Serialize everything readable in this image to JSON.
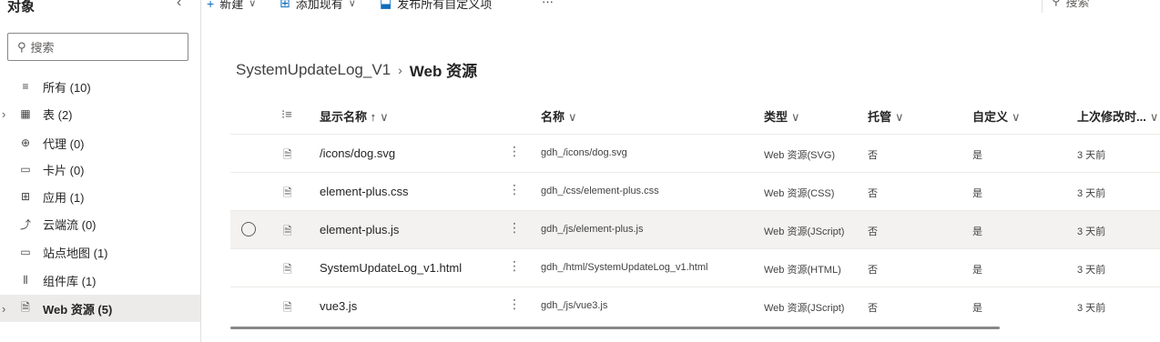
{
  "panel": {
    "title": "对象",
    "collapse_icon": "‹",
    "search_placeholder": "搜索",
    "items": [
      {
        "label": "所有 (10)",
        "icon": "≡",
        "chev": ""
      },
      {
        "label": "表 (2)",
        "icon": "▦",
        "chev": "›"
      },
      {
        "label": "代理 (0)",
        "icon": "⊕",
        "chev": ""
      },
      {
        "label": "卡片 (0)",
        "icon": "▭",
        "chev": ""
      },
      {
        "label": "应用 (1)",
        "icon": "⊞",
        "chev": ""
      },
      {
        "label": "云端流 (0)",
        "icon": "⤴",
        "chev": ""
      },
      {
        "label": "站点地图 (1)",
        "icon": "▭",
        "chev": ""
      },
      {
        "label": "组件库 (1)",
        "icon": "⫴",
        "chev": ""
      },
      {
        "label": "Web 资源 (5)",
        "icon": "🗎",
        "chev": "›"
      }
    ]
  },
  "toolbar": {
    "new_label": "新建",
    "add_existing_label": "添加现有",
    "publish_label": "发布所有自定义项",
    "more_label": "···",
    "search_label": "搜索"
  },
  "breadcrumb": {
    "parent": "SystemUpdateLog_V1",
    "current": "Web 资源"
  },
  "table": {
    "headers": {
      "display_name": "显示名称 ↑",
      "name": "名称",
      "type": "类型",
      "managed": "托管",
      "customizable": "自定义",
      "modified": "上次修改时..."
    },
    "rows": [
      {
        "display": "/icons/dog.svg",
        "name": "gdh_/icons/dog.svg",
        "type": "Web 资源(SVG)",
        "managed": "否",
        "custom": "是",
        "modified": "3 天前"
      },
      {
        "display": "element-plus.css",
        "name": "gdh_/css/element-plus.css",
        "type": "Web 资源(CSS)",
        "managed": "否",
        "custom": "是",
        "modified": "3 天前"
      },
      {
        "display": "element-plus.js",
        "name": "gdh_/js/element-plus.js",
        "type": "Web 资源(JScript)",
        "managed": "否",
        "custom": "是",
        "modified": "3 天前"
      },
      {
        "display": "SystemUpdateLog_v1.html",
        "name": "gdh_/html/SystemUpdateLog_v1.html",
        "type": "Web 资源(HTML)",
        "managed": "否",
        "custom": "是",
        "modified": "3 天前"
      },
      {
        "display": "vue3.js",
        "name": "gdh_/js/vue3.js",
        "type": "Web 资源(JScript)",
        "managed": "否",
        "custom": "是",
        "modified": "3 天前"
      }
    ]
  }
}
